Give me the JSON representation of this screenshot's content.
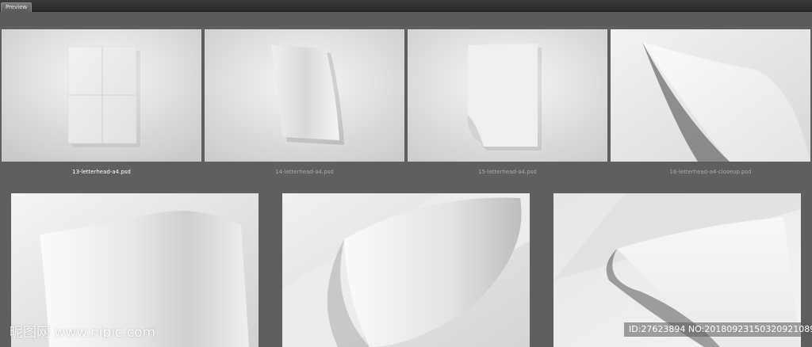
{
  "window": {
    "tab_label": "Preview"
  },
  "gallery": {
    "row1": [
      {
        "file": "13-letterhead-a4.psd",
        "selected": true
      },
      {
        "file": "14-letterhead-a4.psd",
        "selected": false
      },
      {
        "file": "15-letterhead-a4.psd",
        "selected": false
      },
      {
        "file": "16-letterhead-a4-closeup.psd",
        "selected": false
      }
    ],
    "row2_count": 3
  },
  "watermark": {
    "left_text": "昵图网 www.nipic.com",
    "right_text": "ID:27623894 NO:20180923150320921089"
  },
  "colors": {
    "background": "#5f5f5f",
    "paper": "#f2f2f2",
    "caption": "#a9a9a9"
  }
}
